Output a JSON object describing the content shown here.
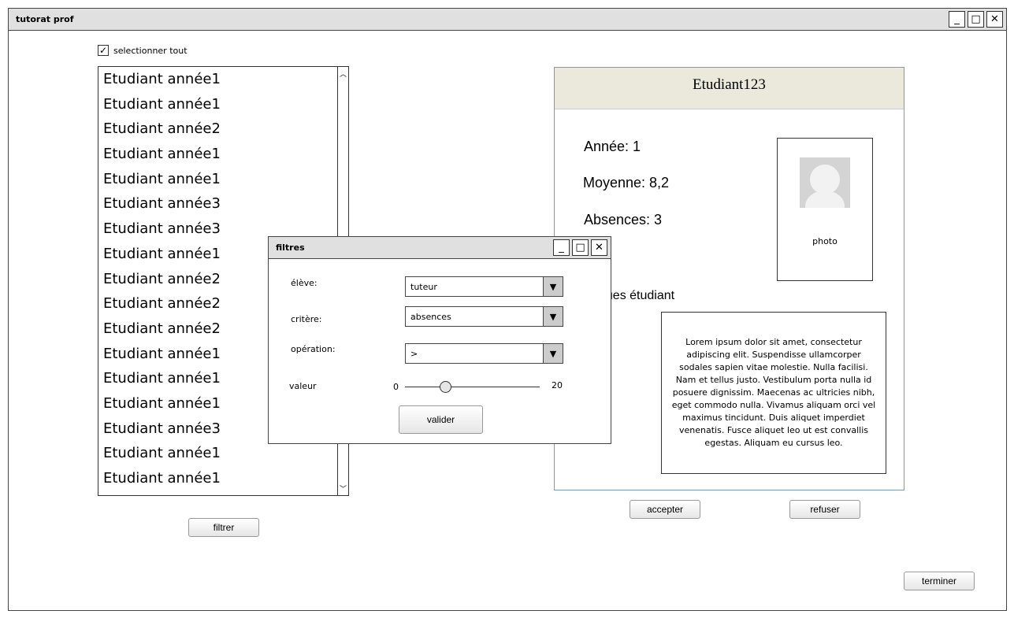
{
  "window": {
    "title": "tutorat prof",
    "minimize": "_",
    "maximize": "□",
    "close": "✕"
  },
  "select_all": {
    "label": "selectionner tout",
    "checked": true
  },
  "students": [
    "Etudiant année1",
    "Etudiant année1",
    "Etudiant année2",
    "Etudiant année1",
    "Etudiant année1",
    "Etudiant année3",
    "Etudiant année3",
    "Etudiant année1",
    "Etudiant année2",
    "Etudiant année2",
    "Etudiant année2",
    "Etudiant année1",
    "Etudiant année1",
    "Etudiant année1",
    "Etudiant année3",
    "Etudiant année1",
    "Etudiant année1"
  ],
  "filter_button": "filtrer",
  "card": {
    "name": "Etudiant123",
    "annee": "Année: 1",
    "moyenne": "Moyenne: 8,2",
    "absences": "Absences: 3",
    "photo_label": "photo",
    "remarks_label": "ques étudiant",
    "remarks": "Lorem ipsum dolor sit amet, consectetur adipiscing elit. Suspendisse ullamcorper sodales sapien vitae molestie. Nulla facilisi. Nam et tellus justo. Vestibulum porta nulla id posuere dignissim. Maecenas ac ultricies nibh, eget commodo nulla. Vivamus aliquam orci vel maximus tincidunt. Duis aliquet imperdiet venenatis. Fusce aliquet leo ut est convallis egestas. Aliquam eu cursus leo."
  },
  "accept": "accepter",
  "refuse": "refuser",
  "finish": "terminer",
  "dialog": {
    "title": "filtres",
    "eleve_label": "élève:",
    "eleve_value": "tuteur",
    "critere_label": "critère:",
    "critere_value": "absences",
    "operation_label": "opération:",
    "operation_value": ">",
    "valeur_label": "valeur",
    "slider_min": "0",
    "slider_max": "20",
    "slider_value": 6,
    "validate": "valider"
  }
}
